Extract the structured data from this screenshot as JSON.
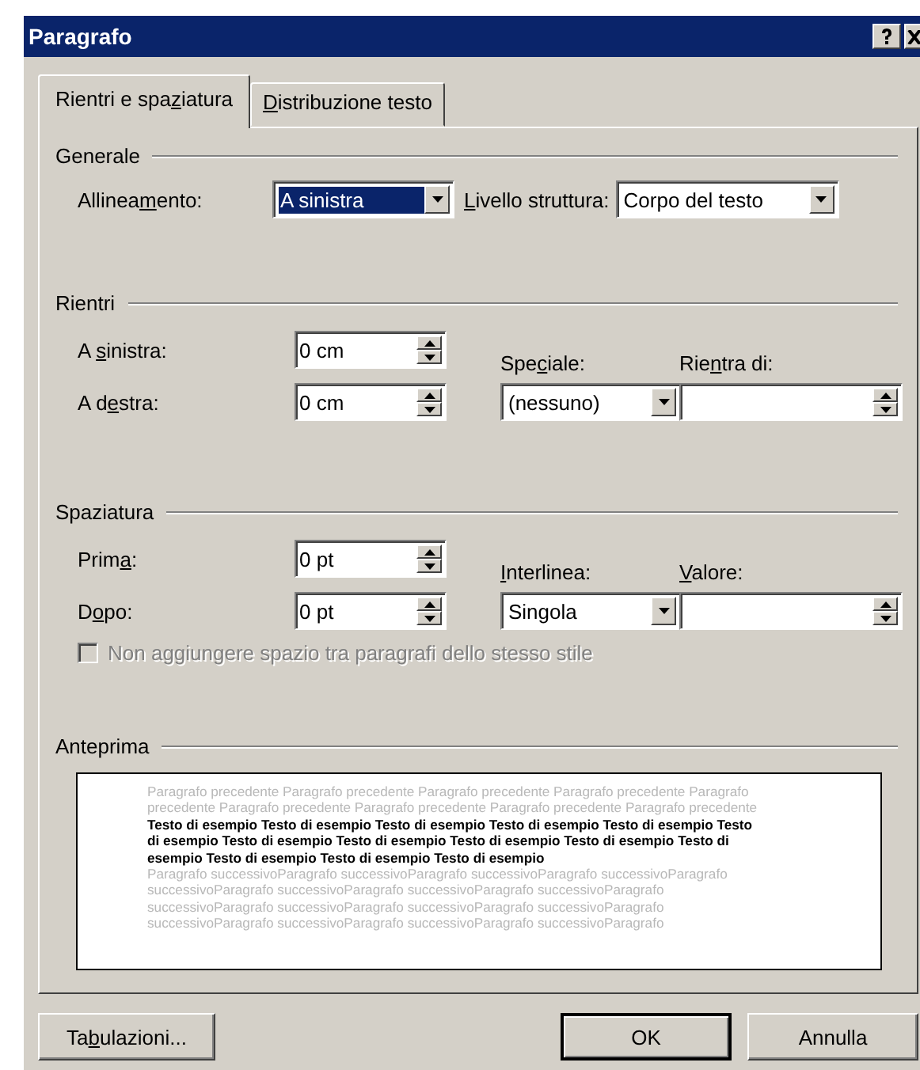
{
  "window": {
    "title": "Paragrafo"
  },
  "tabs": [
    {
      "label": {
        "pre": "Rientri e spa",
        "key": "z",
        "post": "iatura"
      },
      "selected": true
    },
    {
      "label": {
        "key": "D",
        "post": "istribuzione testo"
      },
      "selected": false
    }
  ],
  "generale": {
    "title": "Generale",
    "allineamento": {
      "label": {
        "pre": "Allinea",
        "key": "m",
        "post": "ento:"
      },
      "value": "A sinistra",
      "focused": true
    },
    "livello": {
      "label": {
        "key": "L",
        "post": "ivello struttura:"
      },
      "value": "Corpo del testo",
      "focused": false
    }
  },
  "rientri": {
    "title": "Rientri",
    "sinistra": {
      "label": {
        "pre": "A ",
        "key": "s",
        "post": "inistra:"
      },
      "value": "0 cm"
    },
    "destra": {
      "label": {
        "pre": "A d",
        "key": "e",
        "post": "stra:"
      },
      "value": "0 cm"
    },
    "speciale": {
      "label": {
        "pre": "Spe",
        "key": "c",
        "post": "iale:"
      },
      "value": "(nessuno)",
      "focused": false
    },
    "rientra_di": {
      "label": {
        "pre": "Rie",
        "key": "n",
        "post": "tra di:"
      }
    }
  },
  "spaziatura": {
    "title": "Spaziatura",
    "prima": {
      "label": {
        "pre": "Prim",
        "key": "a",
        "post": ":"
      },
      "value": "0 pt"
    },
    "dopo": {
      "label": {
        "pre": "D",
        "key": "o",
        "post": "po:"
      },
      "value": "0 pt"
    },
    "interlinea": {
      "label": {
        "key": "I",
        "post": "nterlinea:"
      },
      "value": "Singola",
      "focused": false
    },
    "valore": {
      "label": {
        "key": "V",
        "post": "alore:"
      }
    },
    "checkbox": {
      "label": "Non aggiungere spazio tra paragrafi dello stesso stile",
      "checked": false,
      "disabled": true
    }
  },
  "anteprima": {
    "title": "Anteprima",
    "previous_lines": [
      "Paragrafo precedente Paragrafo precedente Paragrafo precedente Paragrafo precedente Paragrafo",
      "precedente Paragrafo precedente Paragrafo precedente Paragrafo precedente Paragrafo precedente"
    ],
    "sample_lines": [
      "Testo di esempio Testo di esempio Testo di esempio Testo di esempio Testo di esempio Testo",
      "di esempio Testo di esempio Testo di esempio Testo di esempio Testo di esempio Testo di",
      "esempio Testo di esempio Testo di esempio Testo di esempio"
    ],
    "next_lines": [
      "Paragrafo successivoParagrafo successivoParagrafo successivoParagrafo successivoParagrafo",
      "successivoParagrafo successivoParagrafo successivoParagrafo successivoParagrafo",
      "successivoParagrafo successivoParagrafo successivoParagrafo successivoParagrafo",
      "successivoParagrafo successivoParagrafo successivoParagrafo successivoParagrafo"
    ]
  },
  "buttons": [
    {
      "kind": "left",
      "label": {
        "pre": "Ta",
        "key": "b",
        "post": "ulazioni..."
      },
      "default": false
    },
    {
      "kind": "right",
      "label": {
        "post": "OK"
      },
      "default": true
    },
    {
      "kind": "right",
      "label": {
        "post": "Annulla"
      },
      "default": false
    }
  ]
}
